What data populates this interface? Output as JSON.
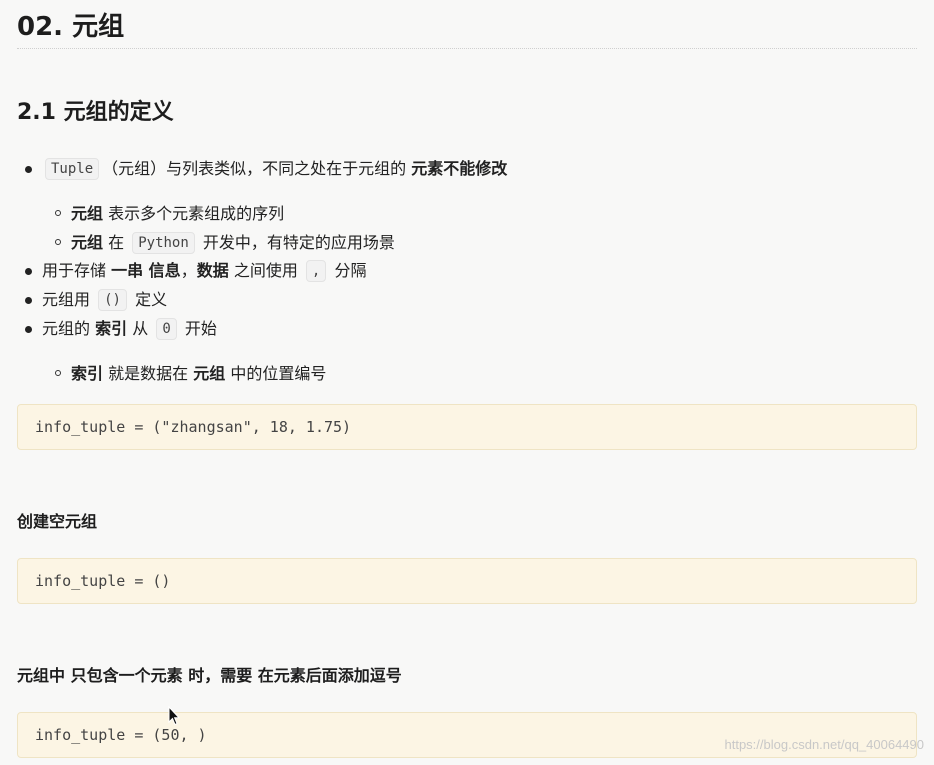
{
  "heading1": "02. 元组",
  "heading2": "2.1 元组的定义",
  "list": {
    "item1": {
      "code": "Tuple",
      "text1": "（元组）与列表类似，不同之处在于元组的",
      "bold": "元素不能修改"
    },
    "item1_sub1": {
      "bold": "元组",
      "text": "表示多个元素组成的序列"
    },
    "item1_sub2": {
      "bold": "元组",
      "text1": "在",
      "code": "Python",
      "text2": "开发中，有特定的应用场景"
    },
    "item2": {
      "text1": "用于存储",
      "bold1": "一串 信息",
      "text2": "，",
      "bold2": "数据",
      "text3": "之间使用",
      "code": ",",
      "text4": "分隔"
    },
    "item3": {
      "text1": "元组用",
      "code": "()",
      "text2": "定义"
    },
    "item4": {
      "text1": "元组的",
      "bold": "索引",
      "text2": "从",
      "code": "0",
      "text3": "开始"
    },
    "item4_sub1": {
      "bold1": "索引",
      "text1": "就是数据在",
      "bold2": "元组",
      "text2": "中的位置编号"
    }
  },
  "code1": "info_tuple = (\"zhangsan\", 18, 1.75)",
  "heading_empty": "创建空元组",
  "code2": "info_tuple = ()",
  "heading_single": {
    "text1": "元组中",
    "text2": "只包含一个元素",
    "text3": "时，需要",
    "text4": "在元素后面添加逗号"
  },
  "code3": "info_tuple = (50, )",
  "watermark": "https://blog.csdn.net/qq_40064490"
}
